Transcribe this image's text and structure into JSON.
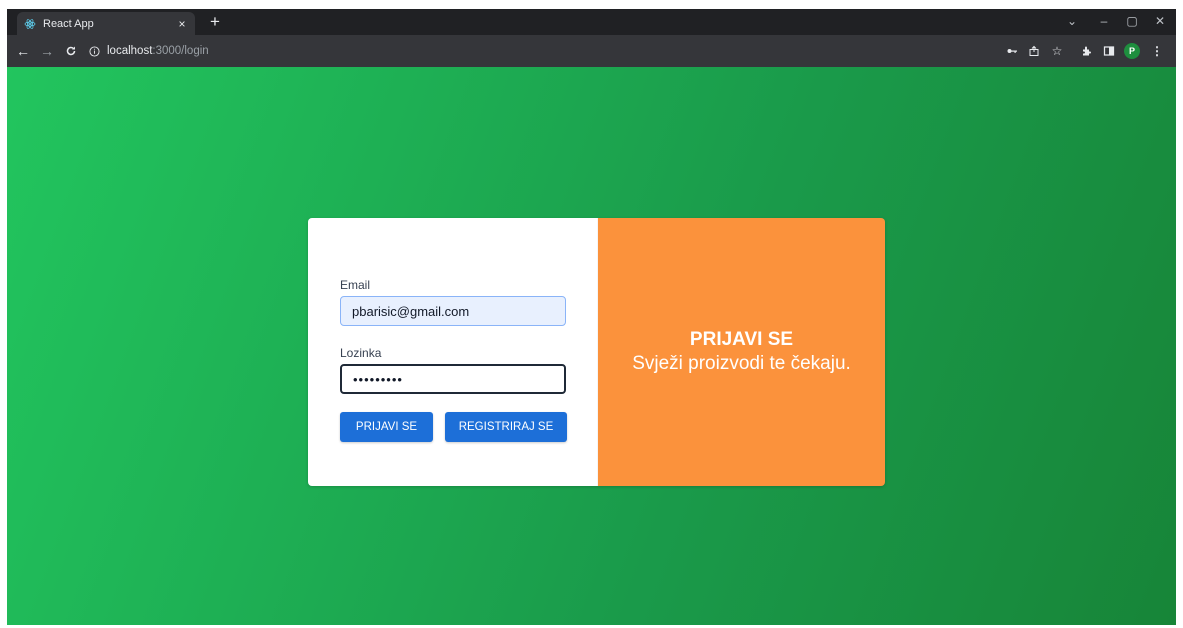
{
  "browser": {
    "tab_title": "React App",
    "tab_close": "×",
    "new_tab": "+",
    "url_host": "localhost",
    "url_path": ":3000/login",
    "window_controls": [
      "⌄",
      "–",
      "▢",
      "✕"
    ]
  },
  "login": {
    "email_label": "Email",
    "email_value": "pbarisic@gmail.com",
    "password_label": "Lozinka",
    "password_value": "•••••••••",
    "login_button": "PRIJAVI SE",
    "register_button": "REGISTRIRAJ SE"
  },
  "hero": {
    "title": "PRIJAVI SE",
    "subtitle": "Svježi proizvodi te čekaju."
  },
  "profile_initial": "P",
  "colors": {
    "background_start": "#22c55e",
    "background_end": "#178538",
    "hero_panel": "#fb923c",
    "primary_button": "#1d6fd8"
  }
}
